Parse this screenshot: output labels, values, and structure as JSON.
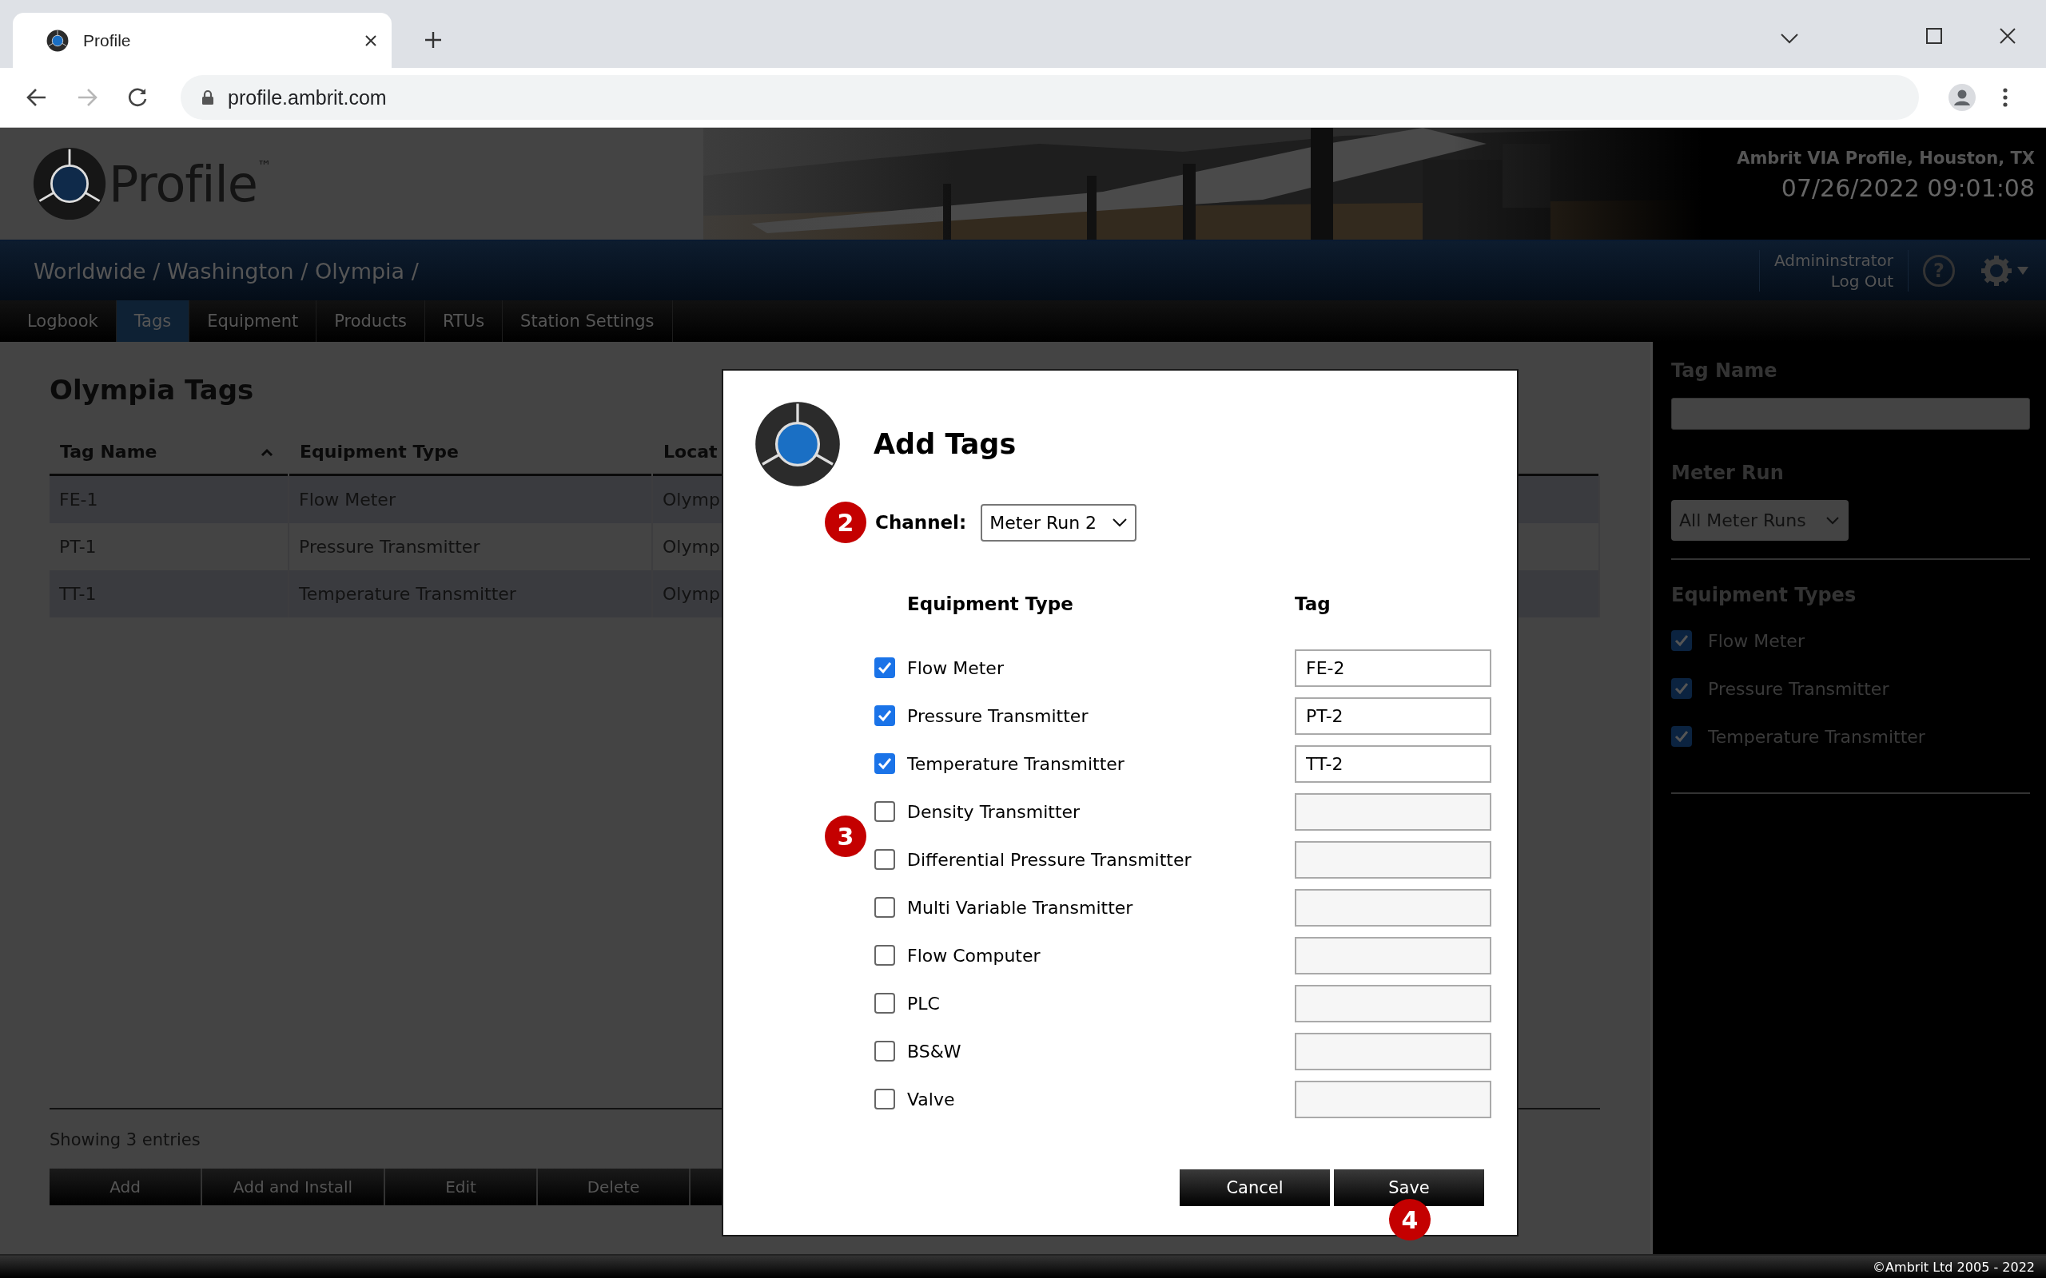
{
  "browser": {
    "tab_title": "Profile",
    "url": "profile.ambrit.com",
    "forward_disabled": true
  },
  "header": {
    "logo": "Profile$^{™}$",
    "site": "Ambrit VIA Profile, Houston, TX",
    "datetime": "07/26/2022 09:01:08"
  },
  "breadcrumb": "Worldwide / Washington / Olympia /",
  "user": {
    "name": "Admininstrator",
    "logout": "Log Out",
    "help": "?"
  },
  "nav_tabs": [
    {
      "label": "Logbook",
      "selected": false
    },
    {
      "label": "Tags",
      "selected": true
    },
    {
      "label": "Equipment",
      "selected": false
    },
    {
      "label": "Products",
      "selected": false
    },
    {
      "label": "RTUs",
      "selected": false
    },
    {
      "label": "Station Settings",
      "selected": false
    }
  ],
  "page": {
    "title": "Olympia Tags",
    "table": {
      "columns": [
        {
          "label": "Tag Name",
          "sorted_ascending": true
        },
        {
          "label": "Equipment Type"
        },
        {
          "label": "Locat"
        }
      ],
      "rows": [
        {
          "cells": [
            "FE-1",
            "Flow Meter",
            "Olymp"
          ]
        },
        {
          "cells": [
            "PT-1",
            "Pressure Transmitter",
            "Olymp"
          ]
        },
        {
          "cells": [
            "TT-1",
            "Temperature Transmitter",
            "Olymp"
          ]
        }
      ]
    },
    "entries": "Showing 3 entries",
    "buttons": [
      "Add",
      "Add and Install",
      "Edit",
      "Delete"
    ]
  },
  "sidebar": {
    "tag_name_label": "Tag Name",
    "meter_run_label": "Meter Run",
    "meter_run_value": "All Meter Runs",
    "equipment_types_label": "Equipment Types",
    "equipment_types": [
      {
        "label": "Flow Meter",
        "checked": true
      },
      {
        "label": "Pressure Transmitter",
        "checked": true
      },
      {
        "label": "Temperature Transmitter",
        "checked": true
      }
    ]
  },
  "dialog": {
    "title": "Add Tags",
    "channel_callout": "2",
    "channel_label": "Channel:",
    "channel_value": "Meter Run 2",
    "columns": [
      "Equipment Type",
      "Tag"
    ],
    "rows_callout": "3",
    "rows": [
      {
        "label": "Flow Meter",
        "checked": true,
        "tag": "FE-2"
      },
      {
        "label": "Pressure Transmitter",
        "checked": true,
        "tag": "PT-2"
      },
      {
        "label": "Temperature Transmitter",
        "checked": true,
        "tag": "TT-2"
      },
      {
        "label": "Density Transmitter",
        "checked": false
      },
      {
        "label": "Differential Pressure Transmitter",
        "checked": false
      },
      {
        "label": "Multi Variable Transmitter",
        "checked": false
      },
      {
        "label": "Flow Computer",
        "checked": false
      },
      {
        "label": "PLC",
        "checked": false
      },
      {
        "label": "BS&W",
        "checked": false
      },
      {
        "label": "Valve",
        "checked": false
      }
    ],
    "buttons": [
      "Cancel",
      "Save"
    ],
    "save_callout": "4"
  },
  "copyright": "©Ambrit Ltd 2005 - 2022"
}
